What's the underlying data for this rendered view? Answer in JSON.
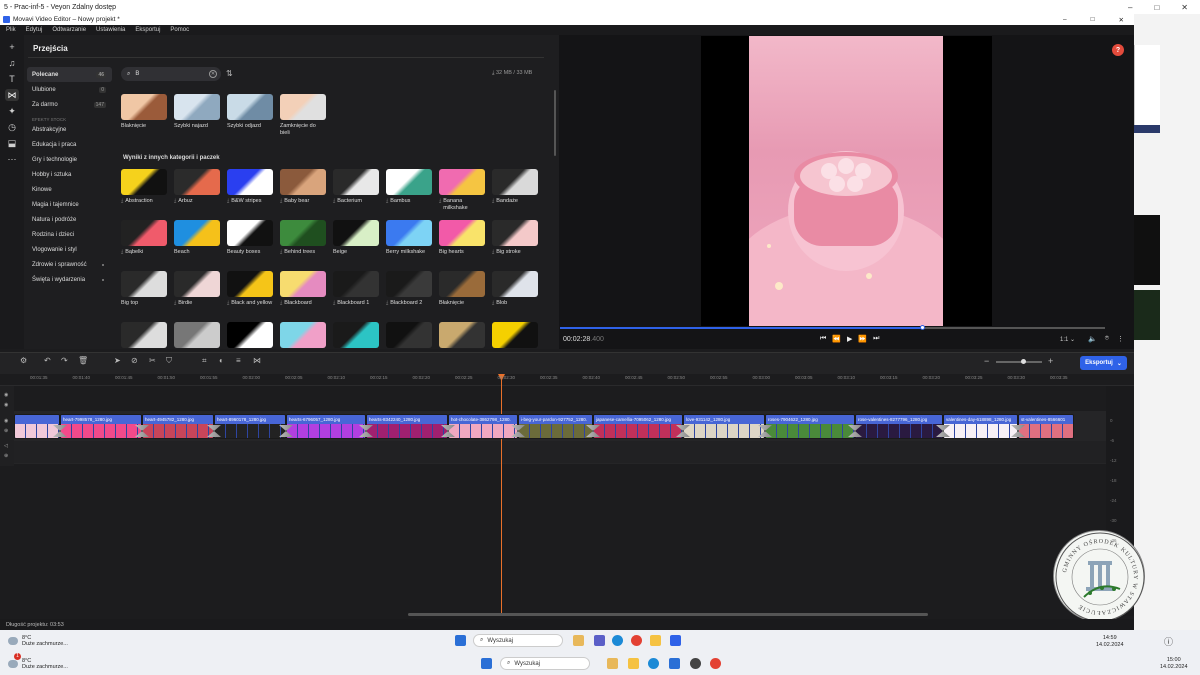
{
  "host": {
    "title": "5 - Prac-inf-5 - Veyon Zdalny dostęp",
    "controls": [
      "–",
      "□",
      "✕"
    ]
  },
  "app": {
    "title": "Movavi Video Editor – Nowy projekt *",
    "controls": [
      "–",
      "□",
      "✕"
    ]
  },
  "menu": [
    "Plik",
    "Edytuj",
    "Odtwarzanie",
    "Ustawienia",
    "Eksportuj",
    "Pomoc"
  ],
  "toolstrip": [
    "plus-icon",
    "music-icon",
    "text-icon",
    "transition-icon",
    "magic-icon",
    "clock-icon",
    "sticker-icon",
    "more-icon"
  ],
  "panel": {
    "title": "Przejścia",
    "search_value": "B",
    "size_info": "32 MB / 33 MB",
    "section_title": "Wyniki z innych kategorii i paczek"
  },
  "categories": [
    {
      "label": "Polecane",
      "count": "46",
      "selected": true
    },
    {
      "label": "Ulubione",
      "count": "0"
    },
    {
      "label": "Za darmo",
      "count": "147"
    }
  ],
  "effects_head": "EFEKTY STOCK",
  "effect_categories": [
    "Abstrakcyjne",
    "Edukacja i praca",
    "Gry i technologie",
    "Hobby i sztuka",
    "Kinowe",
    "Magia i tajemnice",
    "Natura i podróże",
    "Rodzina i dzieci",
    "Vlogowanie i styl",
    "Zdrowie i sprawność",
    "Święta i wydarzenia"
  ],
  "top_tiles": [
    {
      "label": "Blaknięcie",
      "c1": "#f0c7a5",
      "c2": "#9b5b3a"
    },
    {
      "label": "Szybki najazd",
      "c1": "#d8e4ee",
      "c2": "#8fa9bf"
    },
    {
      "label": "Szybki odjazd",
      "c1": "#c9dbe7",
      "c2": "#6f8ca5"
    },
    {
      "label": "Zamknięcie do bieli",
      "c1": "#f3d0b8",
      "c2": "#e0e0e0"
    }
  ],
  "grid_tiles": [
    {
      "label": "Abstraction",
      "c1": "#f5d21c",
      "c2": "#111111",
      "dl": true
    },
    {
      "label": "Arbuz",
      "c1": "#2b2b2b",
      "c2": "#e56a4c",
      "dl": true
    },
    {
      "label": "B&W stripes",
      "c1": "#2a3ff0",
      "c2": "#ffffff",
      "dl": true
    },
    {
      "label": "Baby bear",
      "c1": "#8b5a3c",
      "c2": "#d9a47c",
      "dl": true
    },
    {
      "label": "Bacterium",
      "c1": "#2a2a2a",
      "c2": "#e8e8e8",
      "dl": true
    },
    {
      "label": "Bambus",
      "c1": "#ffffff",
      "c2": "#3aa38a",
      "dl": true
    },
    {
      "label": "Banana milkshake",
      "c1": "#f06bb0",
      "c2": "#f5c542",
      "dl": true
    },
    {
      "label": "Bandaże",
      "c1": "#2a2a2a",
      "c2": "#d9d9d9",
      "dl": true
    },
    {
      "label": "Bąbelki",
      "c1": "#222222",
      "c2": "#f05b6b",
      "dl": true
    },
    {
      "label": "Beach",
      "c1": "#1f8fe0",
      "c2": "#f5c11a",
      "dl": false
    },
    {
      "label": "Beauty boxes",
      "c1": "#ffffff",
      "c2": "#111111",
      "dl": false
    },
    {
      "label": "Behind trees",
      "c1": "#3d8b3d",
      "c2": "#1f4f1f",
      "dl": true
    },
    {
      "label": "Beige",
      "c1": "#111111",
      "c2": "#d8efc6",
      "dl": false
    },
    {
      "label": "Berry milkshake",
      "c1": "#3b7af0",
      "c2": "#7dd3f5",
      "dl": false
    },
    {
      "label": "Big hearts",
      "c1": "#f25aa8",
      "c2": "#f9e36a",
      "dl": false
    },
    {
      "label": "Big stroke",
      "c1": "#2a2a2a",
      "c2": "#f4c9c9",
      "dl": true
    },
    {
      "label": "Big top",
      "c1": "#2a2a2a",
      "c2": "#dddddd",
      "dl": false
    },
    {
      "label": "Birdie",
      "c1": "#2a2a2a",
      "c2": "#efd6d6",
      "dl": true
    },
    {
      "label": "Black and yellow",
      "c1": "#111111",
      "c2": "#f5c518",
      "dl": true
    },
    {
      "label": "Blackboard",
      "c1": "#f7dc6f",
      "c2": "#e58bc0",
      "dl": true
    },
    {
      "label": "Blackboard 1",
      "c1": "#1a1a1a",
      "c2": "#333333",
      "dl": true
    },
    {
      "label": "Blackboard 2",
      "c1": "#1a1a1a",
      "c2": "#3a3a3a",
      "dl": true
    },
    {
      "label": "Błaknięcie",
      "c1": "#2a2a2a",
      "c2": "#9a6b3a",
      "dl": false
    },
    {
      "label": "Blob",
      "c1": "#2a2a2a",
      "c2": "#dfe3ea",
      "dl": true
    },
    {
      "label": "",
      "c1": "#2a2a2a",
      "c2": "#dddddd",
      "dl": false
    },
    {
      "label": "",
      "c1": "#777777",
      "c2": "#cccccc",
      "dl": false
    },
    {
      "label": "",
      "c1": "#000000",
      "c2": "#ffffff",
      "dl": false
    },
    {
      "label": "",
      "c1": "#7ed6e8",
      "c2": "#f0a0c8",
      "dl": false
    },
    {
      "label": "",
      "c1": "#1a1a1a",
      "c2": "#2cc4c4",
      "dl": false
    },
    {
      "label": "",
      "c1": "#111111",
      "c2": "#333333",
      "dl": false
    },
    {
      "label": "",
      "c1": "#c9a96e",
      "c2": "#333333",
      "dl": false
    },
    {
      "label": "",
      "c1": "#f5d000",
      "c2": "#111111",
      "dl": false
    }
  ],
  "preview": {
    "timecode_main": "00:02:28",
    "timecode_ms": ".400",
    "zoom": "1:1",
    "help": "?"
  },
  "transport": [
    "⏮",
    "⏪",
    "▶",
    "⏩",
    "⏭"
  ],
  "timeline": {
    "export_label": "Eksportuj",
    "ruler": [
      "00:01:35",
      "00:01:40",
      "00:01:45",
      "00:01:50",
      "00:01:55",
      "00:02:00",
      "00:02:05",
      "00:02:10",
      "00:02:15",
      "00:02:20",
      "00:02:25",
      "00:02:30",
      "00:02:35",
      "00:02:40",
      "00:02:45",
      "00:02:50",
      "00:02:55",
      "00:03:00",
      "00:03:05",
      "00:03:10",
      "00:03:15",
      "00:03:20",
      "00:03:25",
      "00:03:30",
      "00:03:35"
    ],
    "clips": [
      {
        "name": "",
        "thumb": "#f0c8d8"
      },
      {
        "name": "heart-7998578_1280.jpg",
        "thumb": "#f24a8a"
      },
      {
        "name": "heart-4945782_1280.jpg",
        "thumb": "#c8455a"
      },
      {
        "name": "heart-8960178_1280.jpg",
        "thumb": "#222222"
      },
      {
        "name": "hearts-6796057_1280.jpg",
        "thumb": "#b23fe0"
      },
      {
        "name": "hearts-8342240_1280.jpg",
        "thumb": "#a02070"
      },
      {
        "name": "hot-chocolate-3862798_1280.",
        "thumb": "#f0a8c0"
      },
      {
        "name": "i-beg-your-pardon-927752_1280.",
        "thumb": "#6b6b3a"
      },
      {
        "name": "japanese-camellia-7095062_1280.jpg",
        "thumb": "#c0305a"
      },
      {
        "name": "love-931142_1280.jpg",
        "thumb": "#ddd5c5"
      },
      {
        "name": "roses-7904622_1280.jpg",
        "thumb": "#4a8a3a"
      },
      {
        "name": "rose-valentines-8277796_1280.jpg",
        "thumb": "#2a1a40"
      },
      {
        "name": "valentines-day-618898_1280.jpg",
        "thumb": "#f7f0f5"
      },
      {
        "name": "st-valentines-8566601",
        "thumb": "#e07080"
      }
    ],
    "vu_labels": [
      "0",
      "-6",
      "-12",
      "-18",
      "-24",
      "-30",
      "-36"
    ],
    "status": "Długość projektu: 03:53"
  },
  "taskbar1": {
    "temp": "8°C",
    "weather": "Duże zachmurze...",
    "search": "Wyszukaj",
    "time": "14:59",
    "date": "14.02.2024"
  },
  "taskbar2": {
    "temp": "8°C",
    "weather": "Duże zachmurze...",
    "search": "Wyszukaj",
    "time": "15:00",
    "date": "14.02.2024",
    "badge": "1"
  },
  "seal_text": "GMINNY OŚRODEK KULTURY W STAWICZAŁUCIE"
}
